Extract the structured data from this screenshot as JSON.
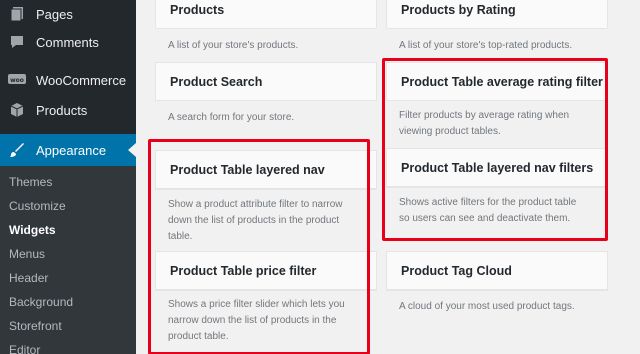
{
  "sidebar": {
    "items": [
      {
        "label": "Pages",
        "icon": "pages-icon"
      },
      {
        "label": "Comments",
        "icon": "comments-icon"
      },
      {
        "label": "WooCommerce",
        "icon": "woocommerce-icon"
      },
      {
        "label": "Products",
        "icon": "products-icon"
      },
      {
        "label": "Appearance",
        "icon": "appearance-icon"
      }
    ],
    "submenu": [
      "Themes",
      "Customize",
      "Widgets",
      "Menus",
      "Header",
      "Background",
      "Storefront",
      "Editor"
    ]
  },
  "widgets": {
    "products": {
      "title": "Products",
      "desc": "A list of your store's products."
    },
    "products_by_rating": {
      "title": "Products by Rating",
      "desc": "A list of your store's top-rated products."
    },
    "product_search": {
      "title": "Product Search",
      "desc": "A search form for your store."
    },
    "avg_rating_filter": {
      "title": "Product Table average rating filter",
      "desc1": "Filter products by average rating when",
      "desc2": "viewing product tables."
    },
    "layered_nav": {
      "title": "Product Table layered nav",
      "desc1": "Show a product attribute filter to narrow",
      "desc2": "down the list of products in the product",
      "desc3": "table."
    },
    "layered_nav_filters": {
      "title": "Product Table layered nav filters",
      "desc1": "Shows active filters for the product table",
      "desc2": "so users can see and deactivate them."
    },
    "price_filter": {
      "title": "Product Table price filter",
      "desc1": "Shows a price filter slider which lets you",
      "desc2": "narrow down the list of products in the",
      "desc3": "product table."
    },
    "tag_cloud": {
      "title": "Product Tag Cloud",
      "desc": "A cloud of your most used product tags."
    }
  },
  "colors": {
    "sidebar": "#23282d",
    "submenu": "#32373c",
    "active": "#0073aa",
    "highlight": "#e8001b"
  }
}
